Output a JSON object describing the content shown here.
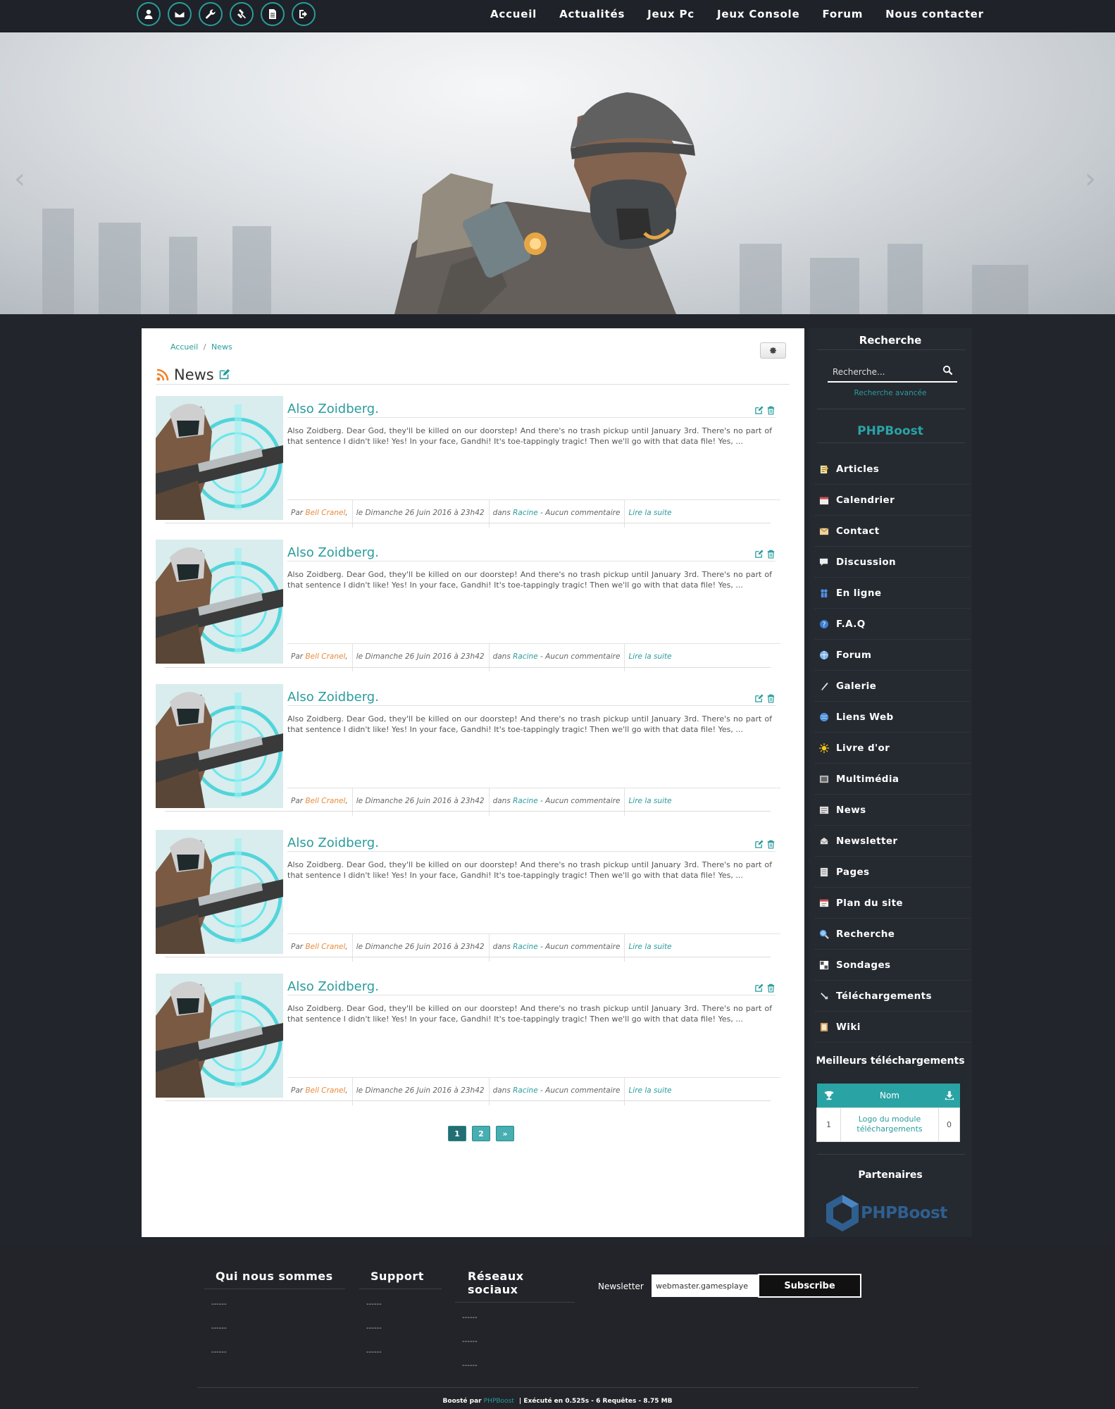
{
  "top_icons": [
    "user-icon",
    "envelope-icon",
    "wrench-icon",
    "gavel-icon",
    "file-icon",
    "sign-out-icon"
  ],
  "top_nav": [
    "Accueil",
    "Actualités",
    "Jeux Pc",
    "Jeux Console",
    "Forum",
    "Nous contacter"
  ],
  "hero": {
    "prev": "‹",
    "next": "›"
  },
  "breadcrumb": {
    "home": "Accueil",
    "sep": "/",
    "current": "News"
  },
  "page_title": "News",
  "news": [
    {
      "title": "Also Zoidberg.",
      "body": "Also Zoidberg. Dear God, they'll be killed on our doorstep! And there's no trash pickup until January 3rd. There's no part of that sentence I didn't like! Yes! In your face, Gandhi! It's toe-tappingly tragic! Then we'll go with that data file! Yes, ...",
      "by": "Par",
      "author": "Bell Cranel",
      "date": "le Dimanche 26 Juin 2016 à 23h42",
      "in": "dans",
      "category": "Racine",
      "comments": "- Aucun commentaire",
      "read_more": "Lire la suite"
    },
    {
      "title": "Also Zoidberg.",
      "body": "Also Zoidberg. Dear God, they'll be killed on our doorstep! And there's no trash pickup until January 3rd. There's no part of that sentence I didn't like! Yes! In your face, Gandhi! It's toe-tappingly tragic! Then we'll go with that data file! Yes, ...",
      "by": "Par",
      "author": "Bell Cranel",
      "date": "le Dimanche 26 Juin 2016 à 23h42",
      "in": "dans",
      "category": "Racine",
      "comments": "- Aucun commentaire",
      "read_more": "Lire la suite"
    },
    {
      "title": "Also Zoidberg.",
      "body": "Also Zoidberg. Dear God, they'll be killed on our doorstep! And there's no trash pickup until January 3rd. There's no part of that sentence I didn't like! Yes! In your face, Gandhi! It's toe-tappingly tragic! Then we'll go with that data file! Yes, ...",
      "by": "Par",
      "author": "Bell Cranel",
      "date": "le Dimanche 26 Juin 2016 à 23h42",
      "in": "dans",
      "category": "Racine",
      "comments": "- Aucun commentaire",
      "read_more": "Lire la suite"
    },
    {
      "title": "Also Zoidberg.",
      "body": "Also Zoidberg. Dear God, they'll be killed on our doorstep! And there's no trash pickup until January 3rd. There's no part of that sentence I didn't like! Yes! In your face, Gandhi! It's toe-tappingly tragic! Then we'll go with that data file! Yes, ...",
      "by": "Par",
      "author": "Bell Cranel",
      "date": "le Dimanche 26 Juin 2016 à 23h42",
      "in": "dans",
      "category": "Racine",
      "comments": "- Aucun commentaire",
      "read_more": "Lire la suite"
    },
    {
      "title": "Also Zoidberg.",
      "body": "Also Zoidberg. Dear God, they'll be killed on our doorstep! And there's no trash pickup until January 3rd. There's no part of that sentence I didn't like! Yes! In your face, Gandhi! It's toe-tappingly tragic! Then we'll go with that data file! Yes, ...",
      "by": "Par",
      "author": "Bell Cranel",
      "date": "le Dimanche 26 Juin 2016 à 23h42",
      "in": "dans",
      "category": "Racine",
      "comments": "- Aucun commentaire",
      "read_more": "Lire la suite"
    }
  ],
  "pagination": [
    "1",
    "2",
    "»"
  ],
  "sidebar": {
    "search_title": "Recherche",
    "search_placeholder": "Recherche...",
    "advanced_search": "Recherche avancée",
    "menu_title": "PHPBoost",
    "menu": [
      {
        "label": "Articles",
        "icon": "articles-icon"
      },
      {
        "label": "Calendrier",
        "icon": "calendar-icon"
      },
      {
        "label": "Contact",
        "icon": "contact-icon"
      },
      {
        "label": "Discussion",
        "icon": "discussion-icon"
      },
      {
        "label": "En ligne",
        "icon": "online-icon"
      },
      {
        "label": "F.A.Q",
        "icon": "faq-icon"
      },
      {
        "label": "Forum",
        "icon": "forum-icon"
      },
      {
        "label": "Galerie",
        "icon": "gallery-icon"
      },
      {
        "label": "Liens Web",
        "icon": "weblinks-icon"
      },
      {
        "label": "Livre d'or",
        "icon": "guestbook-icon"
      },
      {
        "label": "Multimédia",
        "icon": "media-icon"
      },
      {
        "label": "News",
        "icon": "news-icon"
      },
      {
        "label": "Newsletter",
        "icon": "newsletter-icon"
      },
      {
        "label": "Pages",
        "icon": "pages-icon"
      },
      {
        "label": "Plan du site",
        "icon": "sitemap-icon"
      },
      {
        "label": "Recherche",
        "icon": "search-icon"
      },
      {
        "label": "Sondages",
        "icon": "poll-icon"
      },
      {
        "label": "Téléchargements",
        "icon": "downloads-icon"
      },
      {
        "label": "Wiki",
        "icon": "wiki-icon"
      }
    ],
    "downloads_title": "Meilleurs téléchargements",
    "downloads_header": "Nom",
    "downloads": [
      {
        "rank": "1",
        "name": "Logo du module téléchargements",
        "count": "0"
      }
    ],
    "partners_title": "Partenaires",
    "partner_name": "PHPBoost"
  },
  "footer": {
    "col1_title": "Qui nous sommes",
    "col2_title": "Support",
    "col3_title": "Réseaux sociaux",
    "placeholder_link": "------",
    "newsletter_label": "Newsletter",
    "newsletter_value": "webmaster.gamesplaye",
    "subscribe": "Subscribe",
    "credits_prefix": "Boosté par",
    "credits_link": "PHPBoost",
    "credits_suffix": "| Exécuté en 0.525s - 6 Requêtes - 8.75 MB"
  },
  "colors": {
    "accent": "#2a9c9d",
    "author": "#e98b3c",
    "dark_bg": "#22252c",
    "sidebar_bg": "#252930"
  }
}
